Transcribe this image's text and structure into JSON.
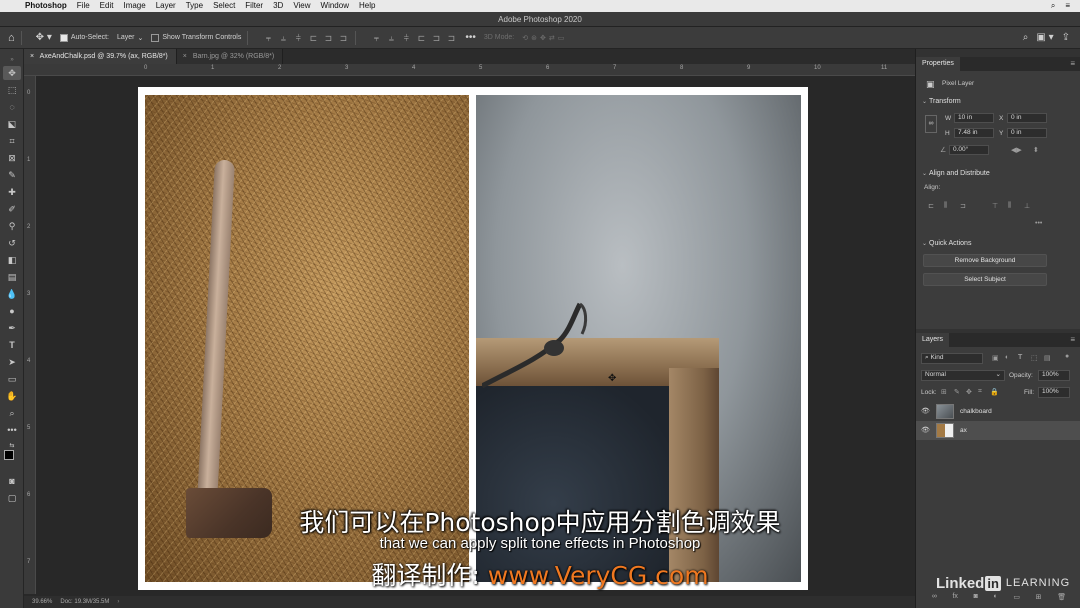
{
  "menubar": {
    "app": "Photoshop",
    "items": [
      "File",
      "Edit",
      "Image",
      "Layer",
      "Type",
      "Select",
      "Filter",
      "3D",
      "View",
      "Window",
      "Help"
    ]
  },
  "window": {
    "title": "Adobe Photoshop 2020"
  },
  "options": {
    "auto_select_label": "Auto-Select:",
    "auto_select_value": "Layer",
    "transform_controls_label": "Show Transform Controls",
    "mode_3d_label": "3D Mode:"
  },
  "tabs": [
    {
      "label": "AxeAndChalk.psd @ 39.7% (ax, RGB/8*)",
      "active": true
    },
    {
      "label": "Barn.jpg @ 32% (RGB/8*)",
      "active": false
    }
  ],
  "ruler": {
    "h": [
      "0",
      "1",
      "2",
      "3",
      "4",
      "5",
      "6",
      "7",
      "8",
      "9",
      "10",
      "11"
    ],
    "v": [
      "0",
      "1",
      "2",
      "3",
      "4",
      "5",
      "6",
      "7"
    ]
  },
  "status": {
    "zoom": "39.66%",
    "doc": "Doc: 19.3M/35.5M"
  },
  "properties": {
    "tab": "Properties",
    "kind": "Pixel Layer",
    "transform": {
      "title": "Transform",
      "w_label": "W",
      "w": "10 in",
      "h_label": "H",
      "h": "7.48 in",
      "x_label": "X",
      "x": "0 in",
      "y_label": "Y",
      "y": "0 in",
      "angle": "0.00°"
    },
    "align": {
      "title": "Align and Distribute",
      "label": "Align:"
    },
    "quick_actions": {
      "title": "Quick Actions",
      "remove_bg": "Remove Background",
      "select_subject": "Select Subject"
    }
  },
  "layers": {
    "tab": "Layers",
    "kind": "Kind",
    "blend": "Normal",
    "opacity_label": "Opacity:",
    "opacity": "100%",
    "lock_label": "Lock:",
    "fill_label": "Fill:",
    "fill": "100%",
    "items": [
      {
        "name": "chalkboard",
        "selected": false
      },
      {
        "name": "ax",
        "selected": true
      }
    ]
  },
  "subtitles": {
    "cn": "我们可以在Photoshop中应用分割色调效果",
    "en": "that we can apply split tone effects in Photoshop",
    "credit_label": "翻译制作:",
    "credit_url": "www.VeryCG.com"
  },
  "watermark": {
    "linked": "Linked",
    "in": "in",
    "learning": "LEARNING"
  },
  "colors": {
    "accent": "#f07820",
    "canvas_bg": "#282828",
    "panel_bg": "#3c3c3c"
  }
}
